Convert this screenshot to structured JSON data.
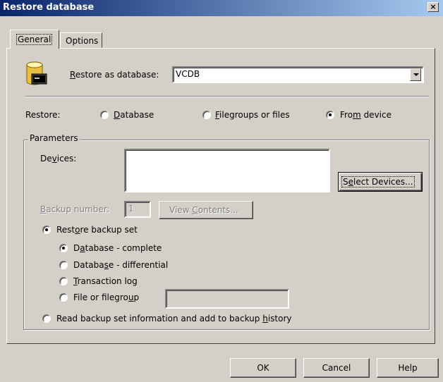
{
  "window": {
    "title": "Restore database",
    "close_glyph": "×"
  },
  "tabs": [
    {
      "label": "General",
      "selected": true
    },
    {
      "label": "Options",
      "selected": false
    }
  ],
  "restore_as": {
    "label_pre": "",
    "label_u": "R",
    "label_post": "estore as database:",
    "value": "VCDB"
  },
  "restore_mode": {
    "label": "Restore:",
    "options": [
      {
        "pre": "",
        "u": "D",
        "post": "atabase",
        "selected": false
      },
      {
        "pre": "",
        "u": "F",
        "post": "ilegroups or files",
        "selected": false
      },
      {
        "pre": "Fro",
        "u": "m",
        "post": " device",
        "selected": true
      }
    ]
  },
  "parameters": {
    "legend": "Parameters",
    "devices_label_pre": "De",
    "devices_label_u": "v",
    "devices_label_post": "ices:",
    "select_devices": {
      "pre": "S",
      "u": "e",
      "post": "lect Devices..."
    },
    "backup_number": {
      "pre": "",
      "u": "B",
      "post": "ackup number:",
      "value": "1"
    },
    "view_contents": {
      "pre": "View ",
      "u": "C",
      "post": "ontents..."
    },
    "restore_backup_set": {
      "pre": "Rest",
      "u": "o",
      "post": "re backup set",
      "selected": true
    },
    "backup_types": [
      {
        "pre": "D",
        "u": "a",
        "post": "tabase - complete",
        "selected": true
      },
      {
        "pre": "Databa",
        "u": "s",
        "post": "e - differential",
        "selected": false
      },
      {
        "pre": "",
        "u": "T",
        "post": "ransaction log",
        "selected": false
      },
      {
        "pre": "File or filegro",
        "u": "u",
        "post": "p",
        "selected": false
      }
    ],
    "read_backup_info": {
      "pre": "Read backup set information and add to backup ",
      "u": "h",
      "post": "istory",
      "selected": false
    }
  },
  "footer": {
    "ok": "OK",
    "cancel": "Cancel",
    "help": "Help"
  },
  "colors": {
    "dialog_bg": "#d4d0c8",
    "title_start": "#0a246a",
    "title_end": "#a6caf0"
  },
  "icons": {
    "database": "database-restore-icon"
  }
}
